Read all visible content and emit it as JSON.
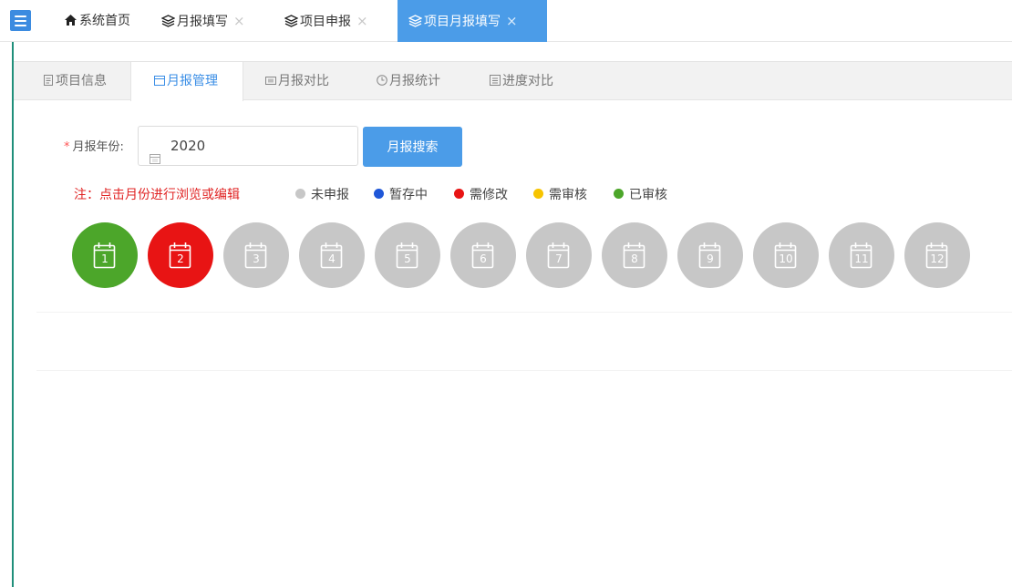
{
  "colors": {
    "accent": "#4b9ce8",
    "approved": "#4ca62a",
    "needs_change": "#e81414",
    "pending_review": "#f7c400",
    "draft": "#1f57d8",
    "unsubmitted": "#c7c7c7"
  },
  "tabs": [
    {
      "label": "系统首页",
      "icon": "home-icon",
      "closable": false,
      "active": false
    },
    {
      "label": "月报填写",
      "icon": "layers-icon",
      "closable": true,
      "active": false
    },
    {
      "label": "项目申报",
      "icon": "layers-icon",
      "closable": true,
      "active": false
    },
    {
      "label": "项目月报填写",
      "icon": "layers-icon",
      "closable": true,
      "active": true
    }
  ],
  "close_symbol": "×",
  "subtabs": [
    {
      "label": "项目信息",
      "icon": "document-icon",
      "active": false
    },
    {
      "label": "月报管理",
      "icon": "calendar-icon",
      "active": true
    },
    {
      "label": "月报对比",
      "icon": "compare-icon",
      "active": false
    },
    {
      "label": "月报统计",
      "icon": "clock-icon",
      "active": false
    },
    {
      "label": "进度对比",
      "icon": "progress-icon",
      "active": false
    }
  ],
  "form": {
    "required_mark": "*",
    "year_label": "月报年份:",
    "year_value": "2020",
    "search_label": "月报搜索"
  },
  "note": "注：点击月份进行浏览或编辑",
  "legend": [
    {
      "label": "未申报",
      "color": "#c7c7c7"
    },
    {
      "label": "暂存中",
      "color": "#1f57d8"
    },
    {
      "label": "需修改",
      "color": "#e81414"
    },
    {
      "label": "需审核",
      "color": "#f7c400"
    },
    {
      "label": "已审核",
      "color": "#4ca62a"
    }
  ],
  "months": [
    {
      "label": "1",
      "status": "已审核",
      "color": "#4ca62a"
    },
    {
      "label": "2",
      "status": "需修改",
      "color": "#e81414"
    },
    {
      "label": "3",
      "status": "未申报",
      "color": "#c7c7c7"
    },
    {
      "label": "4",
      "status": "未申报",
      "color": "#c7c7c7"
    },
    {
      "label": "5",
      "status": "未申报",
      "color": "#c7c7c7"
    },
    {
      "label": "6",
      "status": "未申报",
      "color": "#c7c7c7"
    },
    {
      "label": "7",
      "status": "未申报",
      "color": "#c7c7c7"
    },
    {
      "label": "8",
      "status": "未申报",
      "color": "#c7c7c7"
    },
    {
      "label": "9",
      "status": "未申报",
      "color": "#c7c7c7"
    },
    {
      "label": "10",
      "status": "未申报",
      "color": "#c7c7c7"
    },
    {
      "label": "11",
      "status": "未申报",
      "color": "#c7c7c7"
    },
    {
      "label": "12",
      "status": "未申报",
      "color": "#c7c7c7"
    }
  ]
}
